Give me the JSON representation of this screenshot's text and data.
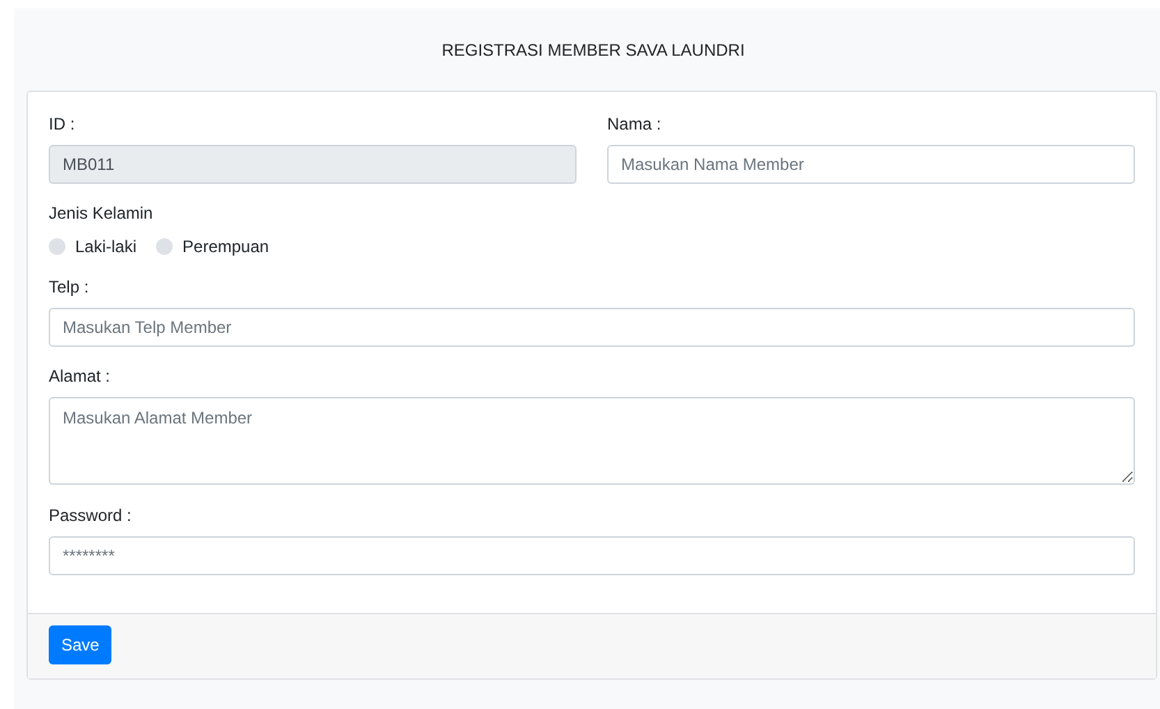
{
  "header": {
    "title": "REGISTRASI MEMBER SAVA LAUNDRI"
  },
  "form": {
    "id": {
      "label": "ID :",
      "value": "MB011",
      "disabled": true
    },
    "nama": {
      "label": "Nama :",
      "placeholder": "Masukan Nama Member"
    },
    "gender": {
      "label": "Jenis Kelamin",
      "options": [
        {
          "label": "Laki-laki",
          "selected": false
        },
        {
          "label": "Perempuan",
          "selected": false
        }
      ]
    },
    "telp": {
      "label": "Telp :",
      "placeholder": "Masukan Telp Member"
    },
    "alamat": {
      "label": "Alamat :",
      "placeholder": "Masukan Alamat Member"
    },
    "password": {
      "label": "Password :",
      "placeholder": "********"
    }
  },
  "footer": {
    "button": "Save"
  }
}
